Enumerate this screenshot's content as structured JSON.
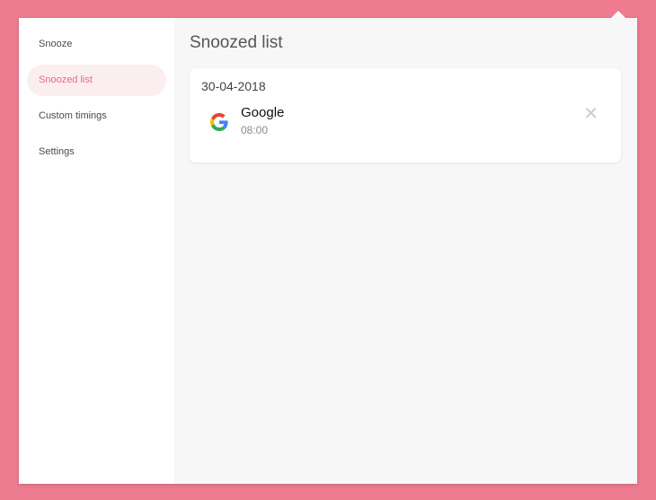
{
  "sidebar": {
    "items": [
      {
        "label": "Snooze",
        "active": false
      },
      {
        "label": "Snoozed list",
        "active": true
      },
      {
        "label": "Custom timings",
        "active": false
      },
      {
        "label": "Settings",
        "active": false
      }
    ]
  },
  "main": {
    "title": "Snoozed list",
    "groups": [
      {
        "date": "30-04-2018",
        "entries": [
          {
            "name": "Google",
            "time": "08:00",
            "icon": "google-icon",
            "remove_icon": "close-icon"
          }
        ]
      }
    ]
  },
  "colors": {
    "background": "#ee7b90",
    "accent": "#ea6b83",
    "active_bg": "#fbeef1"
  }
}
